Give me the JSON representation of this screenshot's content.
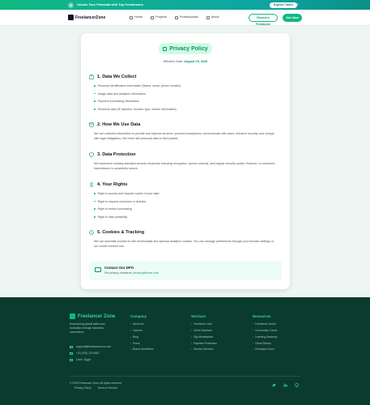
{
  "promo": {
    "text": "Unlock Your Potential with Top Freelancers",
    "button": "Explore Talent",
    "close": "×"
  },
  "nav": {
    "logo": "FreelancerZone",
    "links": [
      "Home",
      "Projects",
      "Professionals",
      "About"
    ],
    "recruit": "Recruit a Freelancer",
    "join": "Join Now"
  },
  "policy": {
    "title": "Privacy Policy",
    "effective_label": "Effective Date:",
    "effective_date": "August 15, 2025",
    "sections": [
      {
        "title": "1. Data We Collect",
        "icon": "clipboard-icon",
        "bullets": [
          "Personal identification information (Name, email, phone number)",
          "Usage data and analytics information",
          "Payment processing information",
          "Technical data (IP address, browser type, device information)"
        ]
      },
      {
        "title": "2. How We Use Data",
        "icon": "database-icon",
        "paragraph": "We use collected information to provide and improve services, process transactions, communicate with users, enhance security, and comply with legal obligations. We never sell personal data to third parties."
      },
      {
        "title": "3. Data Protection",
        "icon": "shield-icon",
        "paragraph": "We implement industry-standard security measures including encryption, access controls, and regular security audits. However, no electronic transmission is completely secure."
      },
      {
        "title": "4. Your Rights",
        "icon": "user-icon",
        "bullets": [
          "Right to access and request copies of your data",
          "Right to request correction or deletion",
          "Right to restrict processing",
          "Right to data portability"
        ]
      },
      {
        "title": "5. Cookies & Tracking",
        "icon": "cookie-icon",
        "paragraph": "We use essential cookies for site functionality and optional analytics cookies. You can manage preferences through your browser settings or our cookie consent tool."
      }
    ],
    "contact": {
      "title": "Contact Our DPO",
      "text": "For privacy concerns:",
      "email": "privacy@fzone.com"
    }
  },
  "footer": {
    "logo": "Freelancer Zone",
    "description": "Empowering global talent and innovation through seamless connections",
    "email": "support@freelancerzone.com",
    "phone": "+20 (100) 123 4567",
    "location": "Cairo, Egypt",
    "columns": [
      {
        "title": "Company",
        "items": [
          "About Us",
          "Careers",
          "Blog",
          "Press",
          "Brand Guidelines"
        ]
      },
      {
        "title": "Services",
        "items": [
          "Freelancer Hub",
          "Client Solutions",
          "Gig Marketplace",
          "Payment Protection",
          "Service Services"
        ]
      },
      {
        "title": "Resources",
        "items": [
          "Freelancer Guide",
          "Community Forum",
          "Learning Academy",
          "Client Stories",
          "Developer Docs"
        ]
      }
    ],
    "copyright": "© 2025 Freelancer Zone. All rights reserved.",
    "legal": [
      "Privacy Policy",
      "Terms of Service"
    ]
  }
}
